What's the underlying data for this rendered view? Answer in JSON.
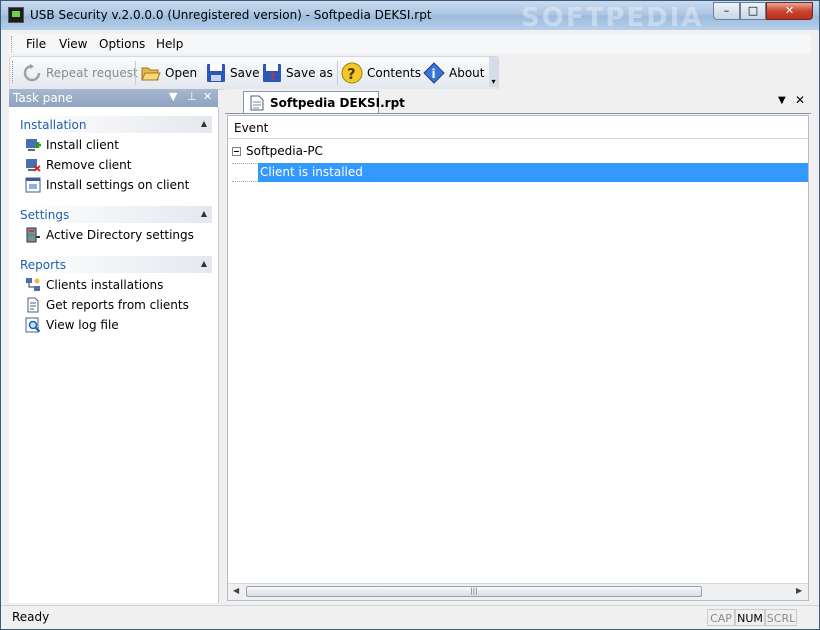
{
  "window": {
    "title": "USB Security v.2.0.0.0 (Unregistered version) - Softpedia DEKSI.rpt",
    "watermark": "SOFTPEDIA",
    "controls": {
      "minimize": "–",
      "maximize": "□",
      "close": "✕"
    }
  },
  "menu": {
    "items": [
      "File",
      "View",
      "Options",
      "Help"
    ]
  },
  "toolbar": {
    "repeat_request": "Repeat request",
    "open": "Open",
    "save": "Save",
    "save_as": "Save as",
    "contents": "Contents",
    "about": "About"
  },
  "task_pane": {
    "title": "Task pane",
    "groups": [
      {
        "title": "Installation",
        "items": [
          "Install client",
          "Remove client",
          "Install settings on client"
        ]
      },
      {
        "title": "Settings",
        "items": [
          "Active Directory settings"
        ]
      },
      {
        "title": "Reports",
        "items": [
          "Clients installations",
          "Get reports from clients",
          "View log file"
        ]
      }
    ]
  },
  "document": {
    "tab_title": "Softpedia DEKSI.rpt",
    "column_header": "Event",
    "tree": {
      "node": "Softpedia-PC",
      "child": "Client is installed"
    }
  },
  "status": {
    "text": "Ready",
    "indicators": {
      "cap": "CAP",
      "num": "NUM",
      "scrl": "SCRL"
    }
  },
  "colors": {
    "accent_blue": "#1f5fae",
    "selection": "#3399ff"
  }
}
